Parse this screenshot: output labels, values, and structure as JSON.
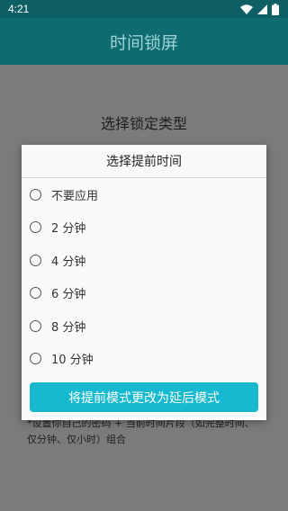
{
  "status_bar": {
    "time": "4:21",
    "icons": [
      "wifi-icon",
      "signal-icon",
      "battery-icon"
    ]
  },
  "app_bar": {
    "title": "时间锁屏"
  },
  "background": {
    "heading": "选择锁定类型",
    "description": "*设置你自己的密码 + 当前时间片段（如完整时间、仅分钟、仅小时）组合"
  },
  "dialog": {
    "title": "选择提前时间",
    "options": [
      {
        "label": "不要应用",
        "selected": false
      },
      {
        "label": "2 分钟",
        "selected": false
      },
      {
        "label": "4 分钟",
        "selected": false
      },
      {
        "label": "6 分钟",
        "selected": false
      },
      {
        "label": "8 分钟",
        "selected": false
      },
      {
        "label": "10 分钟",
        "selected": false
      }
    ],
    "button_label": "将提前模式更改为延后模式"
  },
  "colors": {
    "status_bar": "#0e5f63",
    "app_bar": "#0e6b70",
    "app_title": "#9fd3d6",
    "scrim_background": "#7b7b7b",
    "dialog_bg": "#fafafa",
    "accent_button": "#16b9cf"
  }
}
